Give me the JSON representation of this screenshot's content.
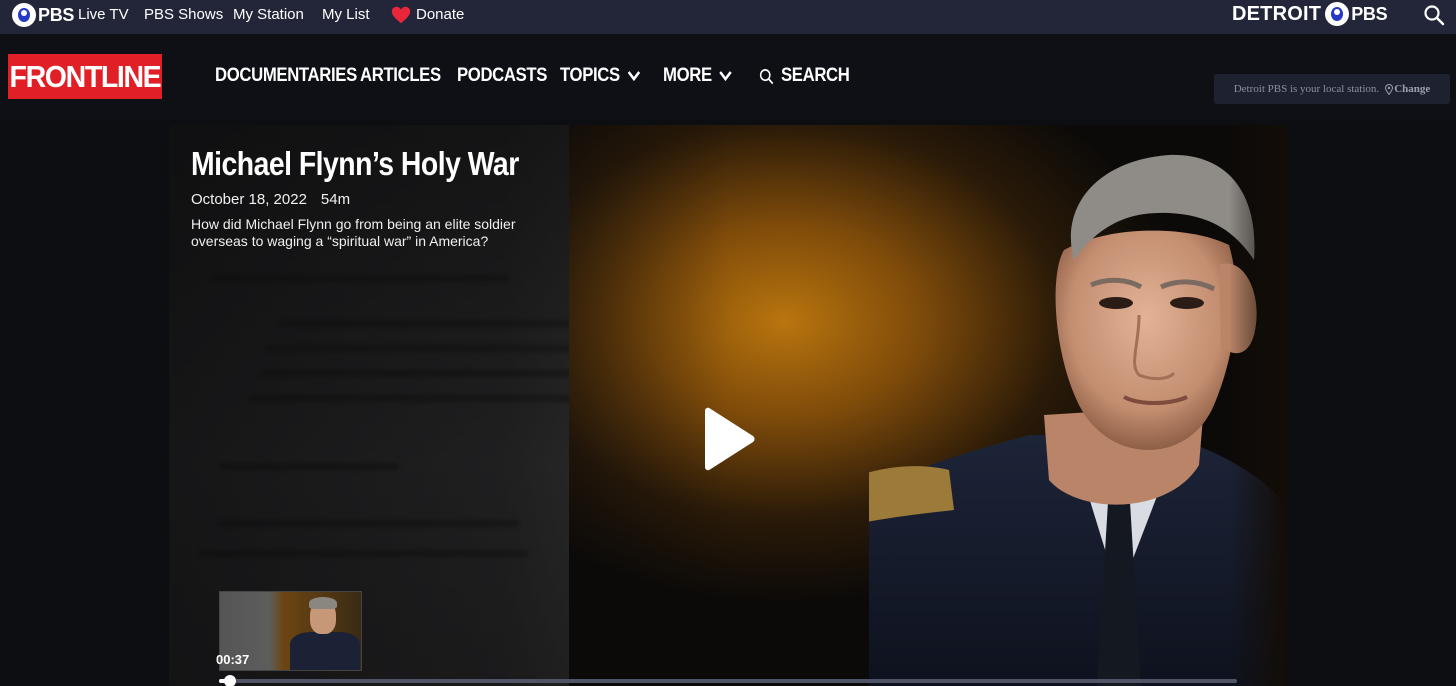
{
  "pbs_bar": {
    "logo_text": "PBS",
    "nav": [
      "Live TV",
      "PBS Shows",
      "My Station",
      "My List"
    ],
    "donate_label": "Donate",
    "station_logo_text": "DETROIT",
    "station_logo_suffix": "PBS",
    "search_icon": "search-icon",
    "heart_color": "#e8273a"
  },
  "header": {
    "logo_text": "FRONTLINE",
    "logo_color": "#e11f26",
    "nav": {
      "documentaries": "DOCUMENTARIES",
      "articles": "ARTICLES",
      "podcasts": "PODCASTS",
      "topics": "TOPICS",
      "more": "MORE",
      "search": "SEARCH"
    },
    "local_station_text": "Detroit PBS is your local station.",
    "local_station_change": "Change"
  },
  "video": {
    "title": "Michael Flynn’s Holy War",
    "date": "October 18, 2022",
    "duration": "54m",
    "description": "How did Michael Flynn go from being an elite soldier overseas to waging a “spiritual war” in America?",
    "preview_timecode": "00:37",
    "progress_fraction": 0.011
  }
}
